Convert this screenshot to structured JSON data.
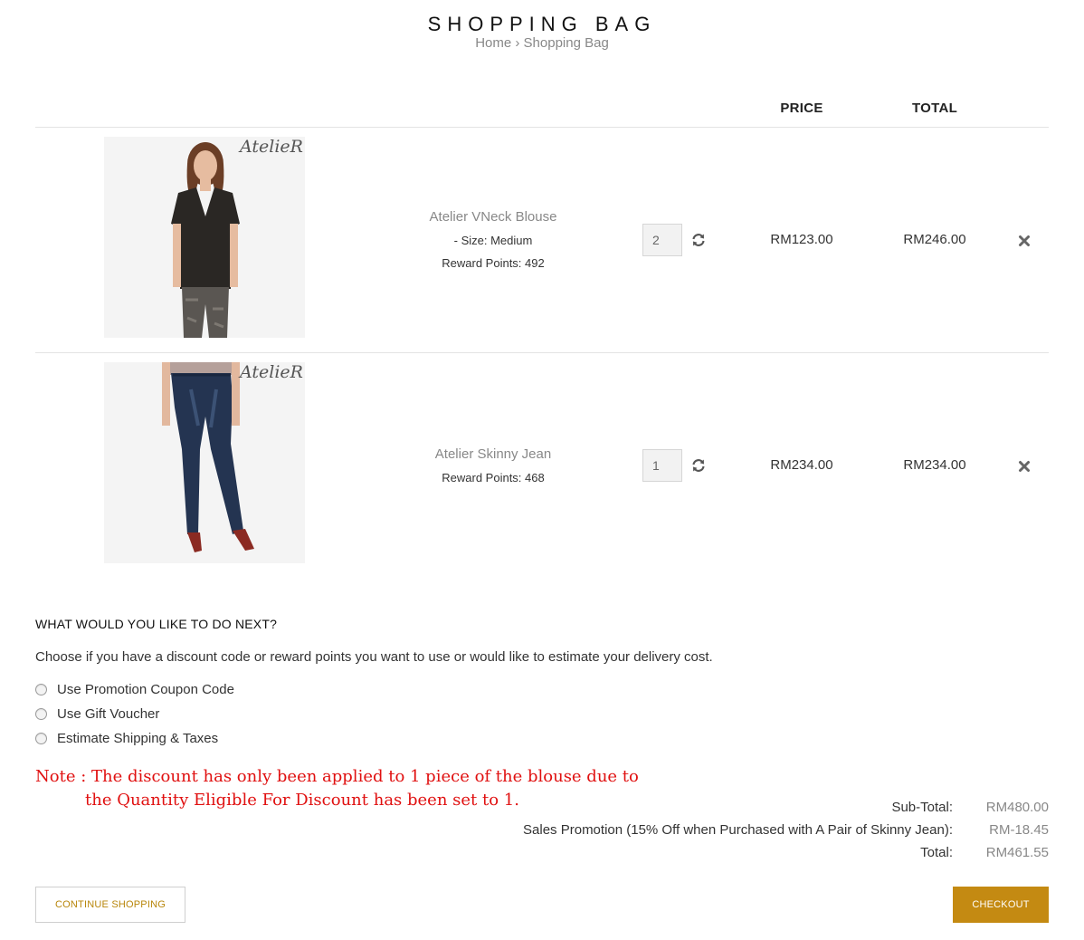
{
  "header": {
    "title": "SHOPPING BAG",
    "breadcrumb": {
      "home": "Home",
      "separator": "›",
      "current": "Shopping Bag"
    }
  },
  "table": {
    "columns": {
      "price": "PRICE",
      "total": "TOTAL"
    }
  },
  "items": [
    {
      "name": "Atelier VNeck Blouse",
      "size": "- Size: Medium",
      "reward": "Reward Points: 492",
      "quantity": "2",
      "price": "RM123.00",
      "total": "RM246.00",
      "brand": "AtelieR",
      "image_icon": "blouse-model-image"
    },
    {
      "name": "Atelier Skinny Jean",
      "reward": "Reward Points: 468",
      "quantity": "1",
      "price": "RM234.00",
      "total": "RM234.00",
      "brand": "AtelieR",
      "image_icon": "jeans-model-image"
    }
  ],
  "next": {
    "title": "WHAT WOULD YOU LIKE TO DO NEXT?",
    "description": "Choose if you have a discount code or reward points you want to use or would like to estimate your delivery cost.",
    "options": [
      "Use Promotion Coupon Code",
      "Use Gift Voucher",
      "Estimate Shipping & Taxes"
    ]
  },
  "note": {
    "line1": "Note : The discount has only been applied to 1 piece of the blouse due to",
    "line2": "the Quantity Eligible For Discount has been set to 1."
  },
  "totals": [
    {
      "label": "Sub-Total:",
      "value": "RM480.00"
    },
    {
      "label": "Sales Promotion (15% Off when Purchased with A Pair of Skinny Jean):",
      "value": "RM-18.45"
    },
    {
      "label": "Total:",
      "value": "RM461.55"
    }
  ],
  "buttons": {
    "continue": "CONTINUE SHOPPING",
    "checkout": "CHECKOUT"
  },
  "colors": {
    "accent": "#c48a12",
    "note": "#e01010",
    "muted": "#888888"
  }
}
